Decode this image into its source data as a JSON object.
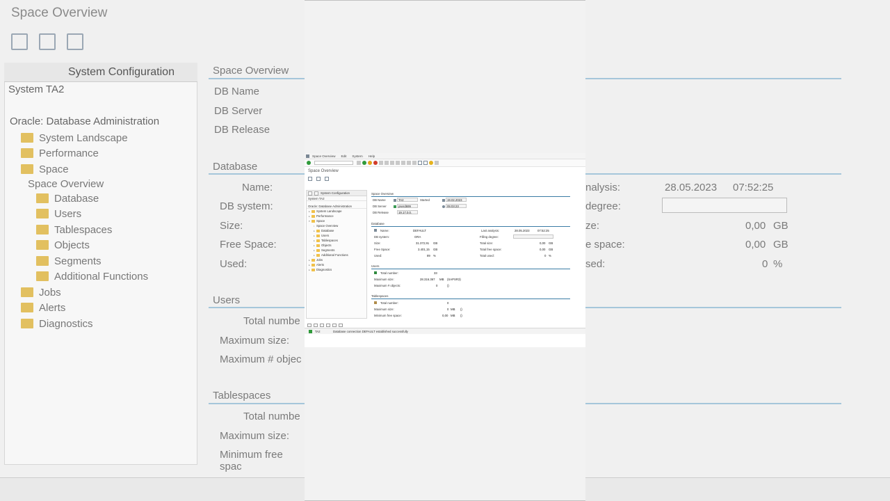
{
  "window": {
    "menu": [
      "Space Overview",
      "Edit",
      "System",
      "Help"
    ],
    "title": "Space Overview"
  },
  "nav": {
    "tab_label": "System Configuration",
    "system_selector": "System TA2",
    "tree_header": "Oracle: Database Administration",
    "tree": [
      {
        "label": "System Landscape",
        "level": 1,
        "folder": true
      },
      {
        "label": "Performance",
        "level": 1,
        "folder": true
      },
      {
        "label": "Space",
        "level": 1,
        "folder": true,
        "open": true
      },
      {
        "label": "Space Overview",
        "level": 2,
        "folder": false
      },
      {
        "label": "Database",
        "level": 2,
        "folder": true
      },
      {
        "label": "Users",
        "level": 2,
        "folder": true
      },
      {
        "label": "Tablespaces",
        "level": 2,
        "folder": true
      },
      {
        "label": "Objects",
        "level": 2,
        "folder": true
      },
      {
        "label": "Segments",
        "level": 2,
        "folder": true
      },
      {
        "label": "Additional Functions",
        "level": 2,
        "folder": true
      },
      {
        "label": "Jobs",
        "level": 1,
        "folder": true
      },
      {
        "label": "Alerts",
        "level": 1,
        "folder": true
      },
      {
        "label": "Diagnostics",
        "level": 1,
        "folder": true
      }
    ]
  },
  "overview": {
    "header": "Space Overview",
    "db_name_label": "DB Name",
    "db_name": "TA2",
    "db_server_label": "DB Server",
    "db_server": "pserd699",
    "db_release_label": "DB Release",
    "db_release": "19.17.0.0.",
    "started_label": "Started",
    "started_date": "19.02.2023",
    "started_time": "05:03:23"
  },
  "database": {
    "header": "Database",
    "name_label": "Name:",
    "name": "DEFAULT",
    "db_system_label": "DB system:",
    "db_system": "ORA",
    "size_label": "Size:",
    "size": "31.372,91",
    "size_unit": "GB",
    "free_label": "Free Space:",
    "free": "3.401,15",
    "free_unit": "GB",
    "used_label": "Used:",
    "used": "89",
    "used_unit": "%",
    "last_analysis_label": "Last analysis:",
    "last_analysis_date": "28.05.2023",
    "last_analysis_time": "07:52:25",
    "filling_label": "Filling degree:",
    "total_size_label": "Total size:",
    "total_size": "0,00",
    "total_size_unit": "GB",
    "total_free_label": "Total free space:",
    "total_free": "0,00",
    "total_free_unit": "GB",
    "total_used_label": "Total used:",
    "total_used": "0",
    "total_used_unit": "%"
  },
  "users": {
    "header": "Users",
    "total_label": "Total number:",
    "total": "33",
    "max_size_label": "Maximum size:",
    "max_size": "28.316.367",
    "max_size_unit": "MB",
    "max_size_owner": "(SAPSR3)",
    "max_objects_label": "Maximum # objects:",
    "max_objects": "0",
    "max_objects_owner": "()"
  },
  "tablespaces": {
    "header": "Tablespaces",
    "total_label": "Total number:",
    "total": "0",
    "max_size_label": "Maximum size:",
    "max_size": "0",
    "max_size_unit": "MB",
    "max_size_owner": "()",
    "min_free_label": "Minimum free space:",
    "min_free": "0,00",
    "min_free_unit": "MB",
    "min_free_owner": "()"
  },
  "status_bar": {
    "system": "TA2",
    "message": "Database connection DEFAULT established successfully"
  },
  "background": {
    "title": "Space Overview",
    "nav_tab": "System Configuration",
    "system": "System TA2",
    "tree_header": "Oracle: Database Administration",
    "tree": [
      "System Landscape",
      "Performance",
      "Space",
      "Space Overview",
      "Database",
      "Users",
      "Tablespaces",
      "Objects",
      "Segments",
      "Additional Functions",
      "Jobs",
      "Alerts",
      "Diagnostics"
    ],
    "left_labels": [
      "Space Overview",
      "DB Name",
      "DB Server",
      "DB Release",
      "Database",
      "Name:",
      "DB system:",
      "Size:",
      "Free Space:",
      "Used:",
      "Users",
      "Total numbe",
      "Maximum size:",
      "Maximum # objec",
      "Tablespaces",
      "Total numbe",
      "Maximum size:",
      "Minimum free spac"
    ],
    "right_labels": [
      "nalysis:",
      "28.05.2023",
      "07:52:25",
      "degree:",
      "ze:",
      "0,00",
      "GB",
      "e space:",
      "0,00",
      "GB",
      "sed:",
      "0",
      "%"
    ]
  }
}
